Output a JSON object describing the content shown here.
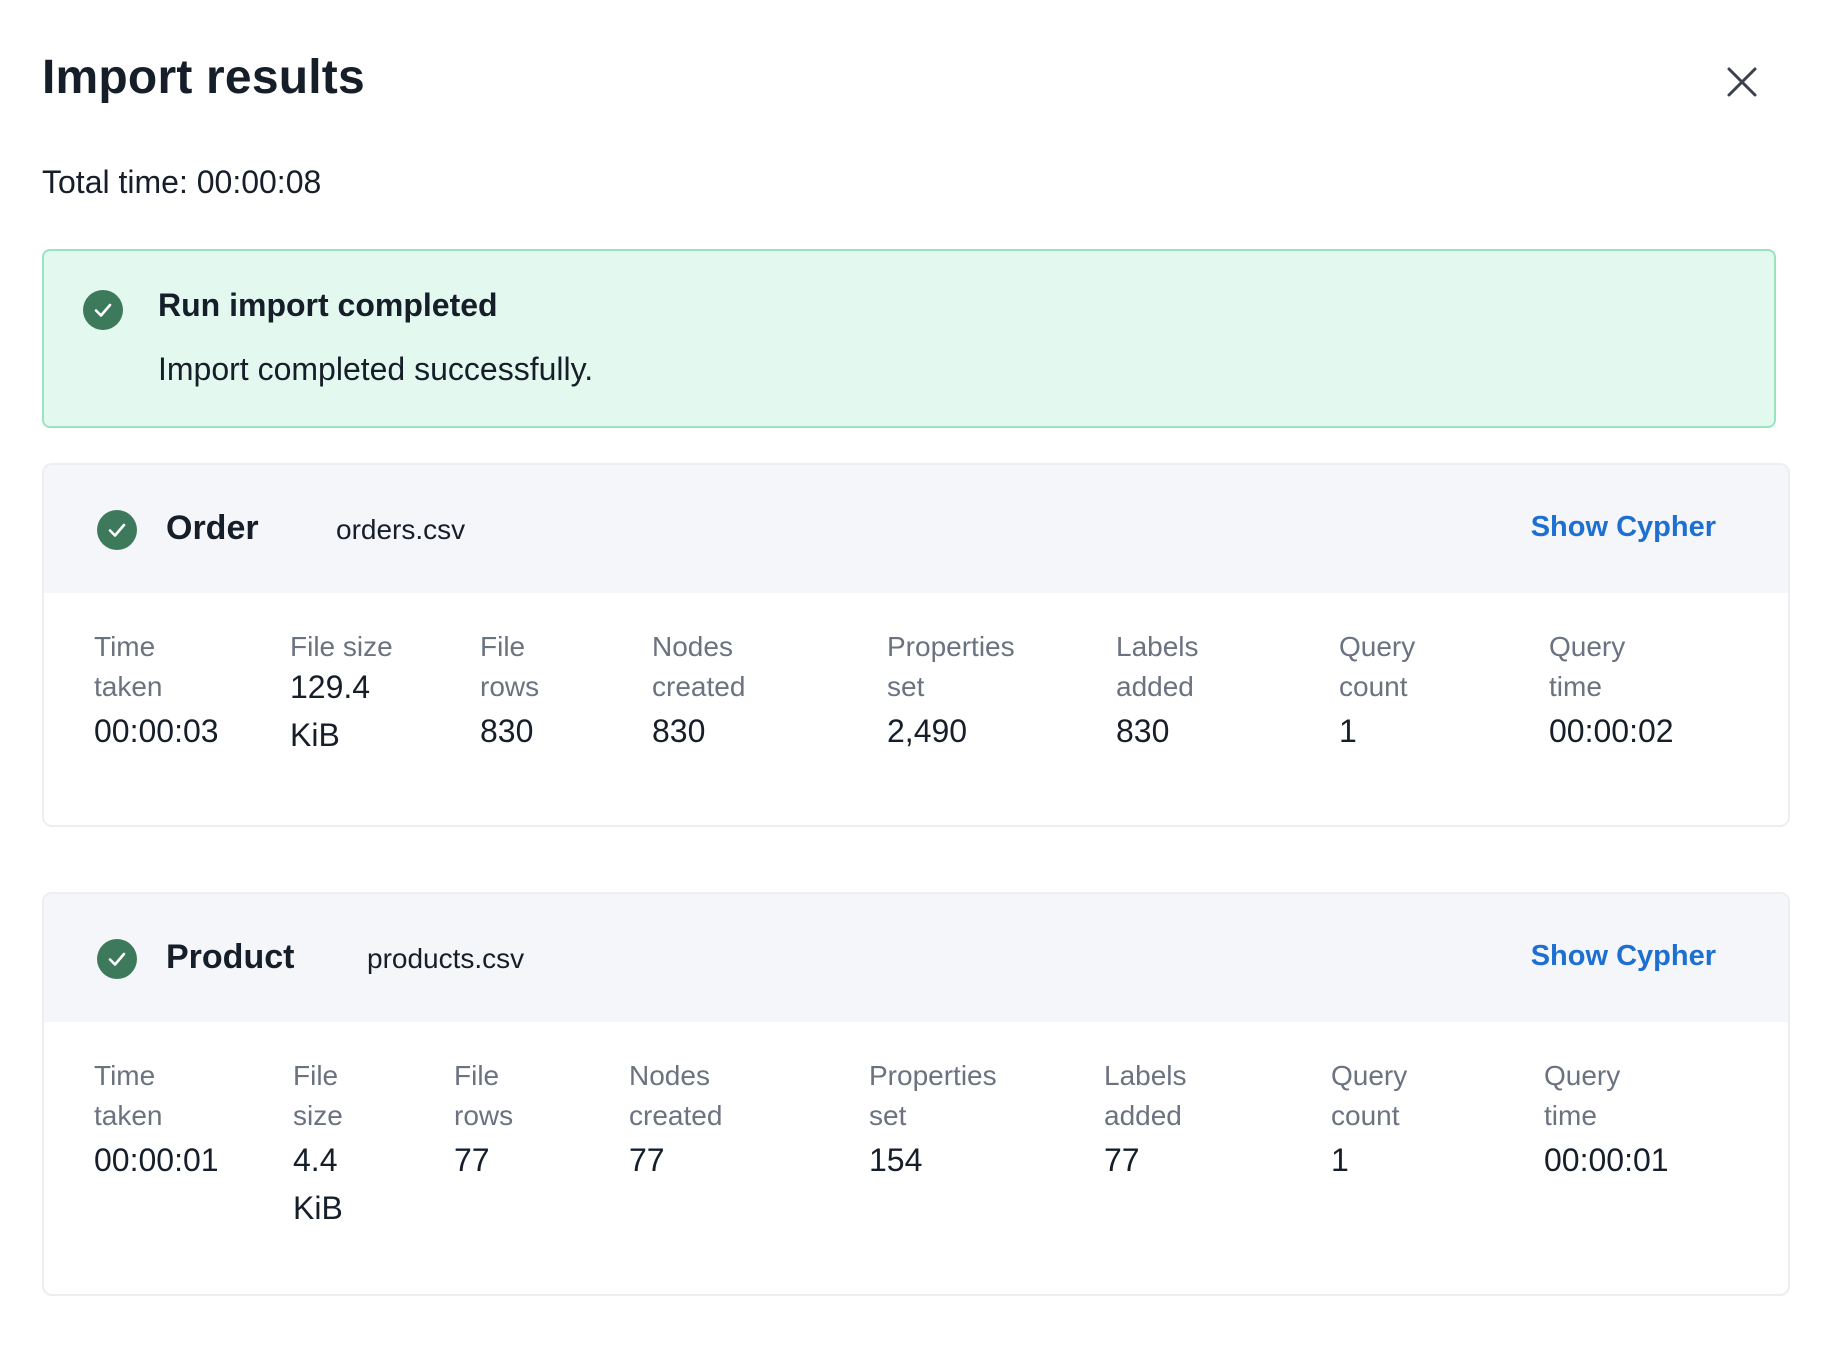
{
  "dialog": {
    "title": "Import results",
    "total_time": "Total time: 00:00:08"
  },
  "banner": {
    "title": "Run import completed",
    "message": "Import completed successfully.",
    "icon": "check-circle-icon",
    "colors": {
      "background": "#e3f8ee",
      "border": "#98e3c0",
      "icon": "#3d7a5c"
    }
  },
  "colors": {
    "link": "#1d6fd1",
    "check": "#3d7a5c",
    "label": "#6b7280"
  },
  "results": [
    {
      "label": "Order",
      "file": "orders.csv",
      "action": "Show Cypher",
      "stats": [
        {
          "label": "Time\ntaken",
          "value": "00:00:03"
        },
        {
          "label": "File size",
          "value": "129.4\nKiB"
        },
        {
          "label": "File\nrows",
          "value": "830"
        },
        {
          "label": "Nodes\ncreated",
          "value": "830"
        },
        {
          "label": "Properties\nset",
          "value": "2,490"
        },
        {
          "label": "Labels\nadded",
          "value": "830"
        },
        {
          "label": "Query\ncount",
          "value": "1"
        },
        {
          "label": "Query\ntime",
          "value": "00:00:02"
        }
      ]
    },
    {
      "label": "Product",
      "file": "products.csv",
      "action": "Show Cypher",
      "stats": [
        {
          "label": "Time\ntaken",
          "value": "00:00:01"
        },
        {
          "label": "File\nsize",
          "value": "4.4\nKiB"
        },
        {
          "label": "File\nrows",
          "value": "77"
        },
        {
          "label": "Nodes\ncreated",
          "value": "77"
        },
        {
          "label": "Properties\nset",
          "value": "154"
        },
        {
          "label": "Labels\nadded",
          "value": "77"
        },
        {
          "label": "Query\ncount",
          "value": "1"
        },
        {
          "label": "Query\ntime",
          "value": "00:00:01"
        }
      ]
    }
  ]
}
